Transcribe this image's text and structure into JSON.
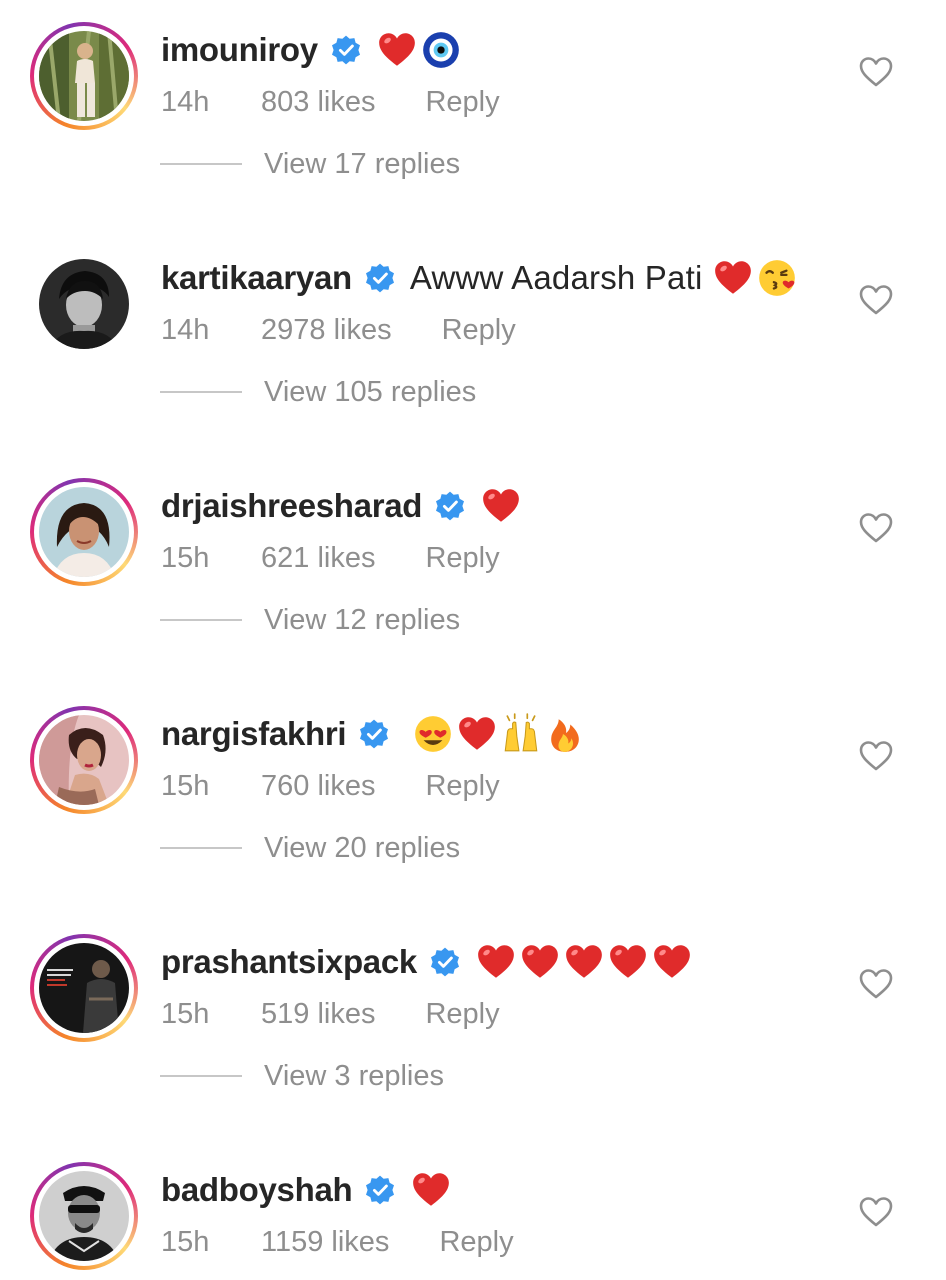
{
  "comments": [
    {
      "username": "imouniroy",
      "verified": true,
      "text": "",
      "emojis": [
        "heart",
        "nazar"
      ],
      "time": "14h",
      "likes": "803 likes",
      "reply_label": "Reply",
      "view_replies": "View 17 replies",
      "story_ring": true
    },
    {
      "username": "kartikaaryan",
      "verified": true,
      "text": "Awww Aadarsh Pati",
      "emojis": [
        "heart",
        "kiss-face"
      ],
      "time": "14h",
      "likes": "2978 likes",
      "reply_label": "Reply",
      "view_replies": "View 105 replies",
      "story_ring": false
    },
    {
      "username": "drjaishreesharad",
      "verified": true,
      "text": "",
      "emojis": [
        "heart"
      ],
      "time": "15h",
      "likes": "621 likes",
      "reply_label": "Reply",
      "view_replies": "View 12 replies",
      "story_ring": true
    },
    {
      "username": "nargisfakhri",
      "verified": true,
      "text": "",
      "emojis": [
        "heart-eyes",
        "heart",
        "raised-hands",
        "fire"
      ],
      "time": "15h",
      "likes": "760 likes",
      "reply_label": "Reply",
      "view_replies": "View 20 replies",
      "story_ring": true
    },
    {
      "username": "prashantsixpack",
      "verified": true,
      "text": "",
      "emojis": [
        "heart",
        "heart",
        "heart",
        "heart",
        "heart"
      ],
      "time": "15h",
      "likes": "519 likes",
      "reply_label": "Reply",
      "view_replies": "View 3 replies",
      "story_ring": true
    },
    {
      "username": "badboyshah",
      "verified": true,
      "text": "",
      "emojis": [
        "heart"
      ],
      "time": "15h",
      "likes": "1159 likes",
      "reply_label": "Reply",
      "view_replies": "",
      "story_ring": true
    }
  ],
  "colors": {
    "verified_blue": "#3897f0",
    "muted_text": "#8e8e8e",
    "primary_text": "#262626",
    "heart_red": "#e0245e"
  }
}
